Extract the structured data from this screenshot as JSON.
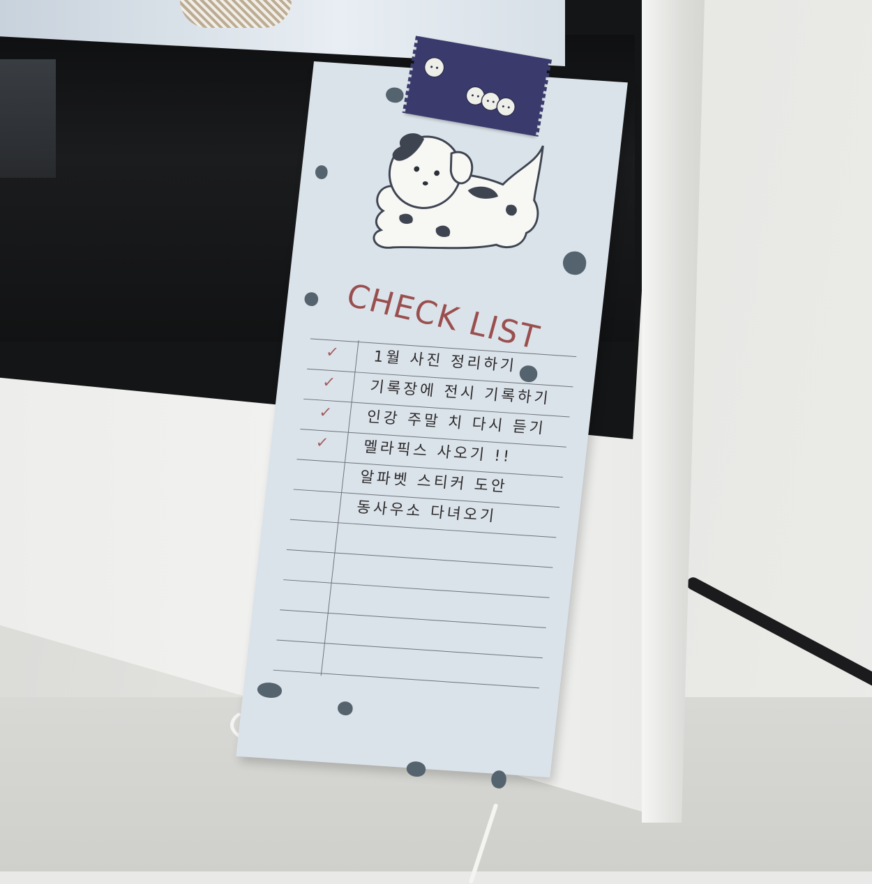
{
  "note": {
    "title": "CHECK LIST",
    "items": [
      {
        "text": "1월 사진 정리하기",
        "done": true
      },
      {
        "text": "기록장에 전시 기록하기",
        "done": true
      },
      {
        "text": "인강 주말 치 다시 듣기",
        "done": true
      },
      {
        "text": "멜라픽스 사오기 !!",
        "done": true
      },
      {
        "text": "알파벳 스티커 도안",
        "done": false
      },
      {
        "text": "동사우소 다녀오기",
        "done": false
      },
      {
        "text": "",
        "done": false
      }
    ],
    "check_mark": "✓",
    "illustration": "dalmatian-puppy",
    "colors": {
      "paper": "#dbe3ea",
      "title": "#9a4f4f",
      "spots": "#55636f",
      "tape": "#3a3b6c"
    }
  }
}
